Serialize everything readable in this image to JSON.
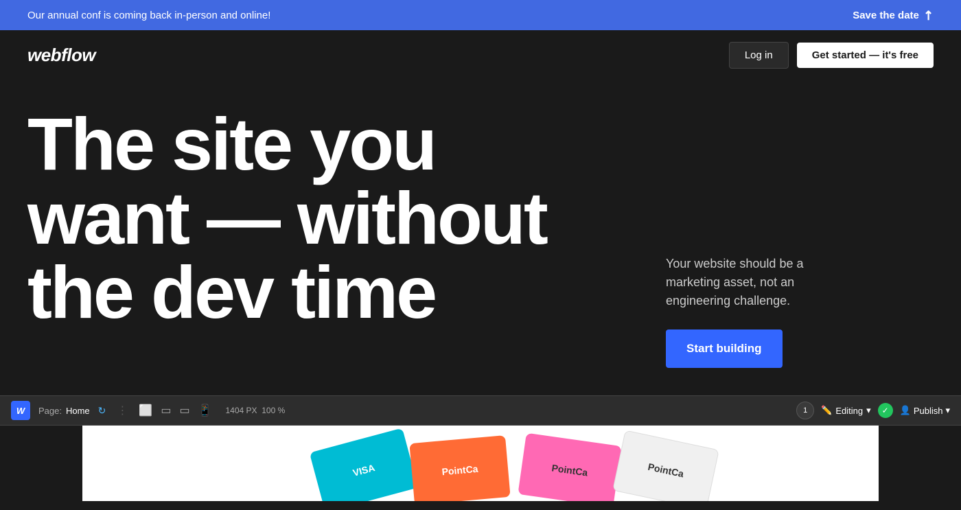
{
  "announcement": {
    "text": "Our annual conf is coming back in-person and online!",
    "cta_text": "Save the date",
    "cta_arrow": "↗"
  },
  "nav": {
    "logo": "webflow",
    "login_label": "Log in",
    "get_started_label": "Get started — it's free"
  },
  "hero": {
    "headline_line1": "The site you",
    "headline_line2": "want — without",
    "headline_line3": "the dev time",
    "description": "Your website should be a marketing asset, not an engineering challenge.",
    "cta_label": "Start building"
  },
  "editor": {
    "logo": "W",
    "page_label": "Page:",
    "page_name": "Home",
    "dimensions": "1404 PX",
    "zoom": "100 %",
    "editing_label": "Editing",
    "publish_label": "Publish",
    "avatar_number": "1"
  },
  "preview": {
    "card1_text": "VISA",
    "card2_text": "PointCa",
    "card3_text": "PointCa",
    "card4_text": "PointCa"
  }
}
